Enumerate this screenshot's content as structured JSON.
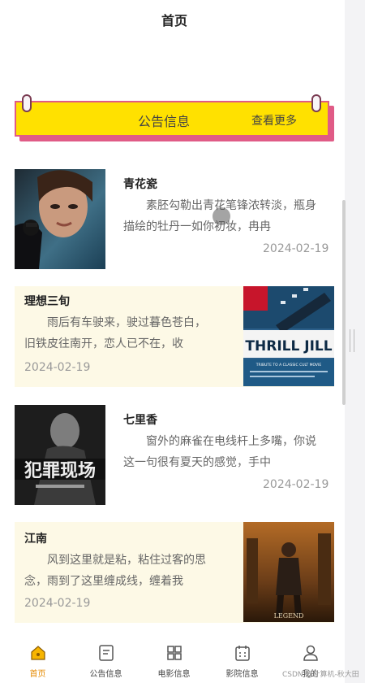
{
  "page_title": "首页",
  "notice": {
    "title": "公告信息",
    "more": "查看更多"
  },
  "songs": [
    {
      "title": "青花瓷",
      "desc": "素胚勾勒出青花笔锋浓转淡，瓶身描绘的牡丹一如你初妆，冉冉",
      "date": "2024-02-19",
      "poster": "movie-poster-leon"
    },
    {
      "title": "理想三旬",
      "desc": "雨后有车驶来，驶过暮色苍白，旧铁皮往南开，恋人已不在，收",
      "date": "2024-02-19",
      "poster": "movie-poster-thrill-jill",
      "poster_text": [
        "THRILL JILL",
        "TRIBUTE TO A CLASSIC CULT MOVIE"
      ]
    },
    {
      "title": "七里香",
      "desc": "窗外的麻雀在电线杆上多嘴，你说这一句很有夏天的感觉，手中",
      "date": "2024-02-19",
      "poster": "movie-poster-crime-scene",
      "poster_text": [
        "犯罪现场"
      ]
    },
    {
      "title": "江南",
      "desc": "风到这里就是粘，粘住过客的思念，雨到了这里缠成线，缠着我",
      "date": "2024-02-19",
      "poster": "movie-poster-legend",
      "poster_text": [
        "LEGEND"
      ]
    }
  ],
  "tabbar": [
    {
      "label": "首页",
      "icon": "home-icon",
      "active": true
    },
    {
      "label": "公告信息",
      "icon": "notice-icon",
      "active": false
    },
    {
      "label": "电影信息",
      "icon": "grid-icon",
      "active": false
    },
    {
      "label": "影院信息",
      "icon": "calendar-icon",
      "active": false
    },
    {
      "label": "我的",
      "icon": "user-icon",
      "active": false
    }
  ],
  "watermark": "CSDN @计算机-秋大田",
  "colors": {
    "accent": "#ffe100",
    "notice_border": "#e05b86",
    "card_shade": "#fdf9e6",
    "active_tab": "#e58a00"
  }
}
